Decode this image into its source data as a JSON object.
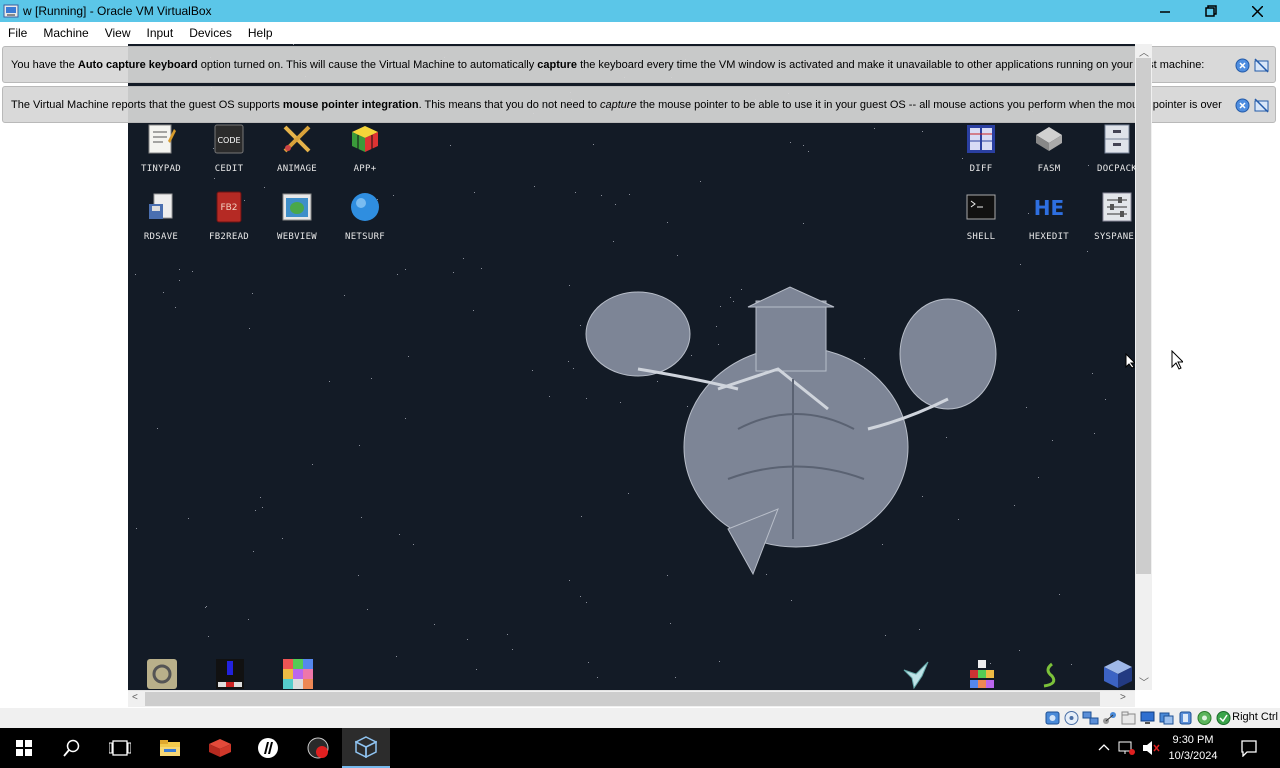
{
  "window": {
    "title": "w [Running] - Oracle VM VirtualBox",
    "minimize_icon": "minimize-icon",
    "restore_icon": "restore-icon",
    "close_icon": "close-icon"
  },
  "menu": [
    "File",
    "Machine",
    "View",
    "Input",
    "Devices",
    "Help"
  ],
  "notices": [
    {
      "pre": "You have the ",
      "b1": "Auto capture keyboard",
      "mid1": " option turned on. This will cause the Virtual Machine to automatically ",
      "b2": "capture",
      "mid2": " the keyboard every time the VM window is activated and make it unavailable to other applications running on your host machine:"
    },
    {
      "pre": "The Virtual Machine reports that the guest OS supports ",
      "b1": "mouse pointer integration",
      "mid1": ". This means that you do not need to ",
      "i1": "capture",
      "mid2": " the mouse pointer to be able to use it in your guest OS -- all mouse actions you perform when the mouse pointer is over"
    }
  ],
  "desktop": {
    "left_icons_row1": [
      "TINYPAD",
      "CEDIT",
      "ANIMAGE",
      "APP+"
    ],
    "left_icons_row2": [
      "RDSAVE",
      "FB2READ",
      "WEBVIEW",
      "NETSURF"
    ],
    "right_icons_row1": [
      "DIFF",
      "FASM",
      "DOCPACK"
    ],
    "right_icons_row2": [
      "SHELL",
      "HEXEDIT",
      "SYSPANEL"
    ],
    "cedit_icon_text": "CODE",
    "fb2_icon_text": "FB2",
    "hexedit_icon_text": "HE"
  },
  "statusbar": {
    "host_key": "Right Ctrl"
  },
  "taskbar": {
    "time": "9:30 PM",
    "date": "10/3/2024"
  },
  "colors": {
    "titlebar": "#5bc6e8",
    "desktop_bg": "#131b26",
    "taskbar": "#000000",
    "accent": "#76b9ed"
  }
}
